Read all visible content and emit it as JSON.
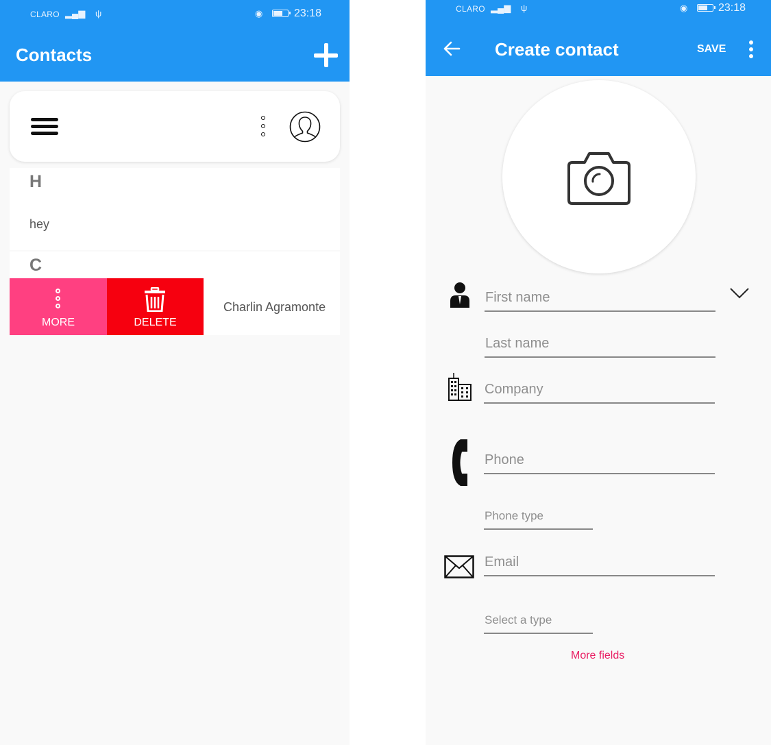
{
  "status_bar": {
    "carrier": "CLARO",
    "time": "23:18"
  },
  "contacts_screen": {
    "title": "Contacts",
    "sections": [
      {
        "letter": "H",
        "contacts": [
          "hey"
        ]
      },
      {
        "letter": "C",
        "contacts": [
          "Charlin Agramonte"
        ]
      }
    ],
    "swipe_actions": {
      "more_label": "MORE",
      "delete_label": "DELETE"
    }
  },
  "create_screen": {
    "title": "Create contact",
    "save_label": "SAVE",
    "fields": {
      "first_name": "First name",
      "last_name": "Last name",
      "company": "Company",
      "phone": "Phone",
      "phone_type": "Phone type",
      "email": "Email",
      "email_type": "Select a type"
    },
    "more_fields_label": "More fields"
  },
  "colors": {
    "primary": "#2196f3",
    "more_action": "#ff4081",
    "delete_action": "#f6000f",
    "link": "#e91e63"
  }
}
